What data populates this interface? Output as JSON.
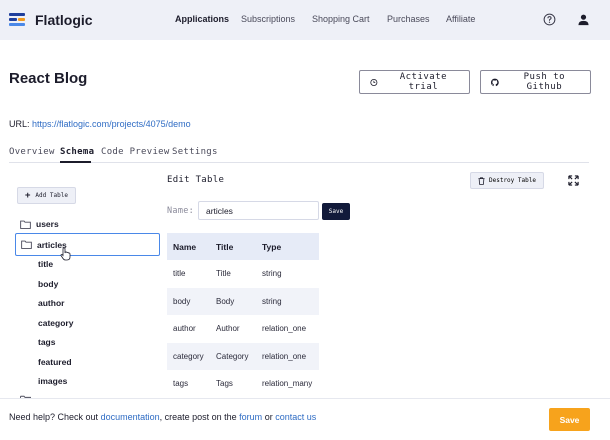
{
  "brand": {
    "name": "Flatlogic",
    "colors": [
      "#1f3f9c",
      "#f29a1b",
      "#4a88e8"
    ]
  },
  "nav": {
    "items": [
      {
        "label": "Applications",
        "active": true
      },
      {
        "label": "Subscriptions",
        "active": false
      },
      {
        "label": "Shopping Cart",
        "active": false
      },
      {
        "label": "Purchases",
        "active": false
      },
      {
        "label": "Affiliate",
        "active": false
      }
    ],
    "icons": [
      "help-circle-icon",
      "user-icon"
    ]
  },
  "header": {
    "title": "React Blog",
    "activate_label": "Activate trial",
    "push_label": "Push to Github"
  },
  "url": {
    "prefix": "URL:",
    "link": "https://flatlogic.com/projects/4075/demo"
  },
  "tabs": [
    {
      "label": "Overview",
      "active": false
    },
    {
      "label": "Schema",
      "active": true
    },
    {
      "label": "Code Preview",
      "active": false
    },
    {
      "label": "Settings",
      "active": false
    }
  ],
  "tree": {
    "add_label": "Add Table",
    "tables": [
      {
        "name": "users",
        "selected": false
      },
      {
        "name": "articles",
        "selected": true
      }
    ],
    "fields": [
      "title",
      "body",
      "author",
      "category",
      "tags",
      "featured",
      "images"
    ]
  },
  "editor": {
    "title": "Edit Table",
    "destroy_label": "Destroy Table",
    "name_label": "Name:",
    "name_value": "articles",
    "save_label": "Save",
    "columns": [
      "Name",
      "Title",
      "Type"
    ],
    "rows": [
      [
        "title",
        "Title",
        "string"
      ],
      [
        "body",
        "Body",
        "string"
      ],
      [
        "author",
        "Author",
        "relation_one"
      ],
      [
        "category",
        "Category",
        "relation_one"
      ],
      [
        "tags",
        "Tags",
        "relation_many"
      ]
    ]
  },
  "footer": {
    "text_1": "Need help? Check out ",
    "link_docs": "documentation",
    "text_2": ", create post on the ",
    "link_forum": "forum",
    "text_3": " or ",
    "link_contact": "contact us",
    "save_label": "Save",
    "save_color": "#f7a31c"
  }
}
